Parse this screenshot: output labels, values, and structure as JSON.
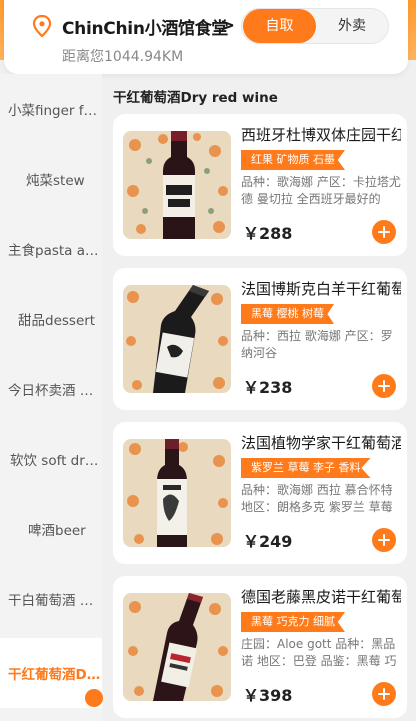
{
  "header": {
    "store_name": "ChinChin小酒馆食堂",
    "chevron": ">",
    "distance": "距离您1044.94KM",
    "mode_active": "自取",
    "mode_inactive": "外卖"
  },
  "sidebar": {
    "items": [
      {
        "label": "小菜finger food"
      },
      {
        "label": "炖菜stew"
      },
      {
        "label": "主食pasta and rice"
      },
      {
        "label": "甜品dessert"
      },
      {
        "label": "今日杯卖酒 wine"
      },
      {
        "label": "软饮 soft drink"
      },
      {
        "label": "啤酒beer"
      },
      {
        "label": "干白葡萄酒 Dry white wine"
      },
      {
        "label": "干红葡萄酒Dry red wine"
      }
    ],
    "active_index": 8
  },
  "section": {
    "title": "干红葡萄酒Dry red wine"
  },
  "products": [
    {
      "name": "西班牙杜博双体庄园干红葡萄酒",
      "tag": "红果 矿物质 石墨",
      "desc": "品种：歌海娜 产区：卡拉塔尤德 曼切拉 全西班牙最好的",
      "price": "￥288",
      "photo": "wine-bottle-double-label"
    },
    {
      "name": "法国博斯克白羊干红葡萄酒",
      "tag": "黑莓 樱桃 树莓",
      "desc": "品种：西拉 歌海娜 产区：罗纳河谷",
      "price": "￥238",
      "photo": "wine-bottle-horse-label"
    },
    {
      "name": "法国植物学家干红葡萄酒",
      "tag": "紫罗兰 草莓 李子 香料",
      "desc": "品种：歌海娜 西拉 慕合怀特 地区：朗格多克 紫罗兰 草莓",
      "price": "￥249",
      "photo": "wine-bottle-botanist-label"
    },
    {
      "name": "德国老藤黑皮诺干红葡萄酒",
      "tag": "黑莓 巧克力 细腻",
      "desc": "庄园：Aloe gott 品种：黑品诺 地区：巴登 品鉴：黑莓 巧克力",
      "price": "￥398",
      "photo": "wine-bottle-old-vine-label"
    }
  ],
  "colors": {
    "accent": "#ff7a1a",
    "header_gradient_top": "#ff9a2e"
  }
}
